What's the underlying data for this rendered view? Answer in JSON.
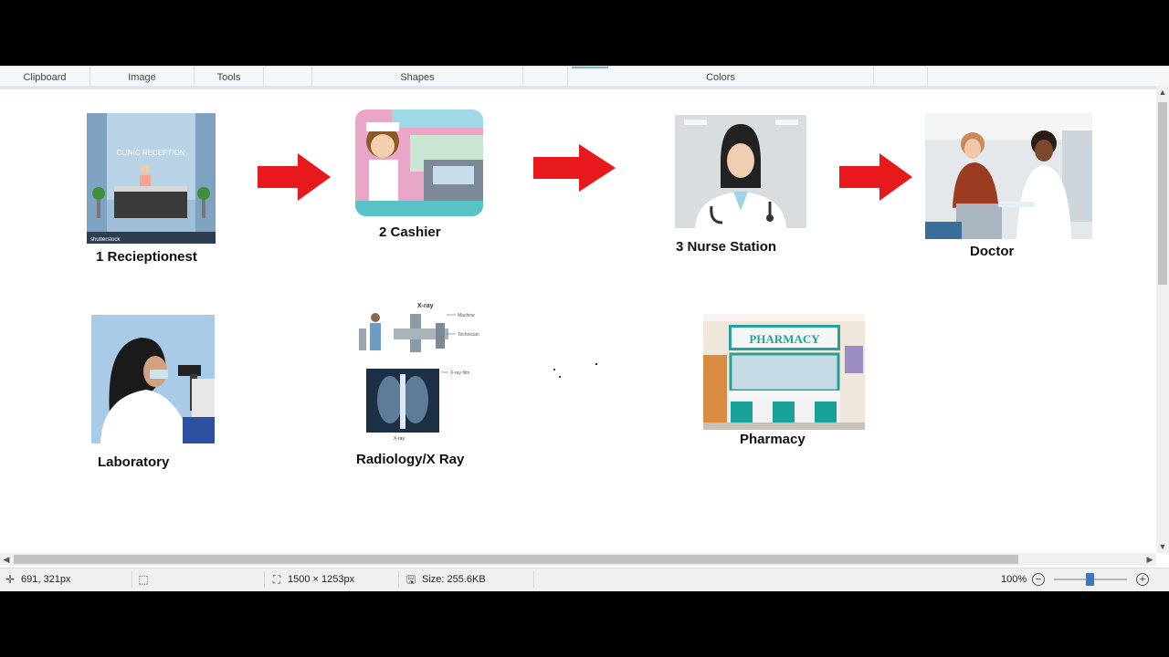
{
  "ribbon": {
    "groups": [
      "Clipboard",
      "Image",
      "Tools",
      "Shapes",
      "Colors"
    ]
  },
  "canvas": {
    "items": [
      {
        "caption": "1 Recieptionest",
        "sign": "CLINIC RECEPTION",
        "watermark": "shutterstock"
      },
      {
        "caption": "2 Cashier"
      },
      {
        "caption": "3 Nurse Station"
      },
      {
        "caption": "Doctor"
      },
      {
        "caption": "Laboratory"
      },
      {
        "caption": "Radiology/X Ray",
        "xray_title": "X-ray",
        "xray_labels": [
          "Machine",
          "Technician",
          "X-ray film"
        ],
        "xray_bottom": "X-ray"
      },
      {
        "caption": "Pharmacy",
        "sign": "PHARMACY"
      }
    ]
  },
  "status": {
    "cursor_position": "691, 321px",
    "image_dimensions": "1500 × 1253px",
    "file_size": "Size: 255.6KB",
    "zoom": "100%"
  },
  "colors": {
    "arrow": "#e8191c",
    "scrollbar": "#c2c2c2",
    "zoom_accent": "#3a78c4"
  }
}
